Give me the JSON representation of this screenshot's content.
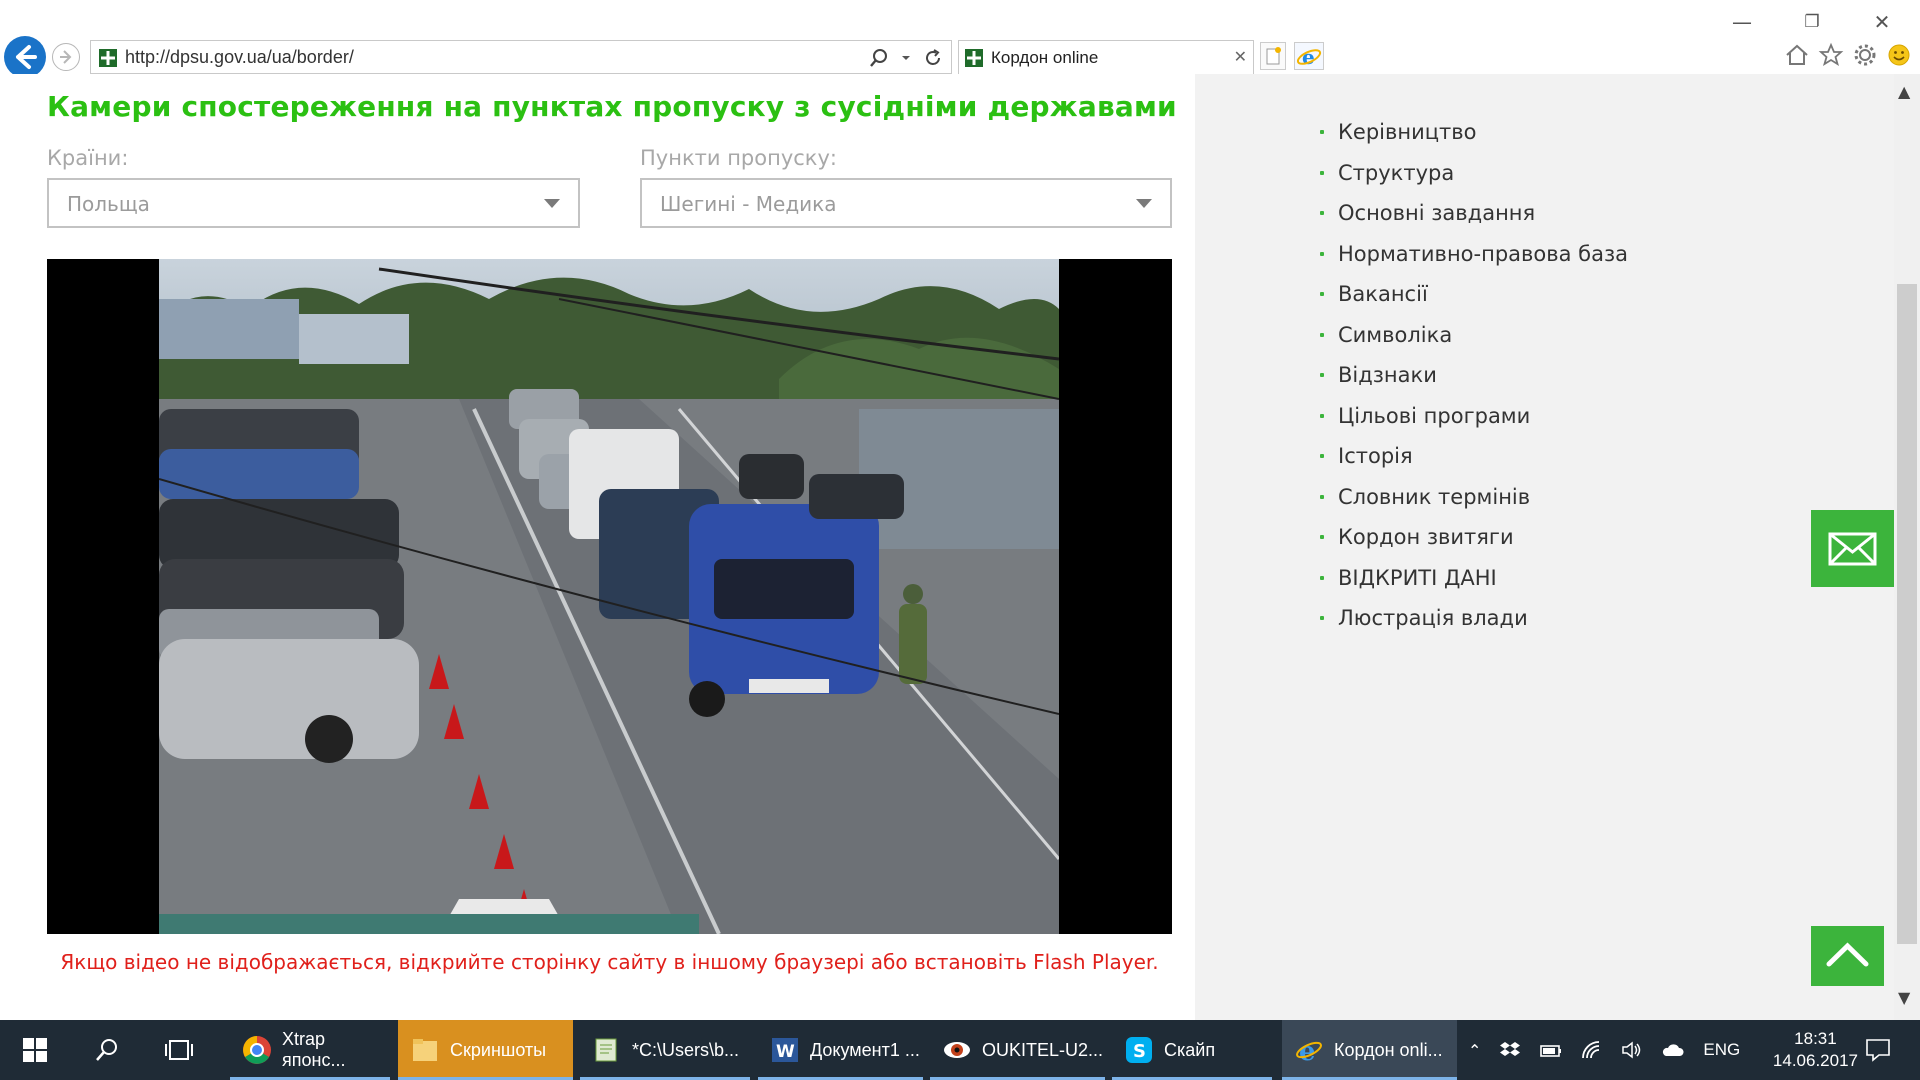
{
  "browser": {
    "url": "http://dpsu.gov.ua/ua/border/",
    "tab_title": "Кордон online",
    "tab_close": "✕"
  },
  "page": {
    "title": "Камери спостереження на пунктах пропуску з сусідніми державами",
    "countries_label": "Країни:",
    "countries_value": "Польща",
    "checkpoints_label": "Пункти пропуску:",
    "checkpoints_value": "Шегині - Медика",
    "notice": "Якщо відео не відображається, відкрийте сторінку сайту в іншому браузері або встановіть Flash Player."
  },
  "sidebar": {
    "items": [
      {
        "label": "Керівництво"
      },
      {
        "label": "Структура"
      },
      {
        "label": "Основні завдання"
      },
      {
        "label": "Нормативно-правова база"
      },
      {
        "label": "Вакансії"
      },
      {
        "label": "Символіка"
      },
      {
        "label": "Відзнаки"
      },
      {
        "label": "Цільові програми"
      },
      {
        "label": "Історія"
      },
      {
        "label": "Словник термінів"
      },
      {
        "label": "Кордон звитяги"
      },
      {
        "label": "ВІДКРИТІ ДАНІ"
      },
      {
        "label": "Люстрація влади"
      }
    ]
  },
  "taskbar": {
    "items": [
      {
        "label": "Xtrap японс..."
      },
      {
        "label": "Скриншоты"
      },
      {
        "label": "*C:\\Users\\b..."
      },
      {
        "label": "Документ1 ..."
      },
      {
        "label": "OUKITEL-U2..."
      },
      {
        "label": "Скайп"
      },
      {
        "label": "Кордон onli..."
      }
    ],
    "lang": "ENG",
    "time": "18:31",
    "date": "14.06.2017"
  },
  "colors": {
    "accent_green": "#3cb43c",
    "title_green": "#2bc012",
    "notice_red": "#e0201b",
    "taskbar": "#1f2b36"
  }
}
